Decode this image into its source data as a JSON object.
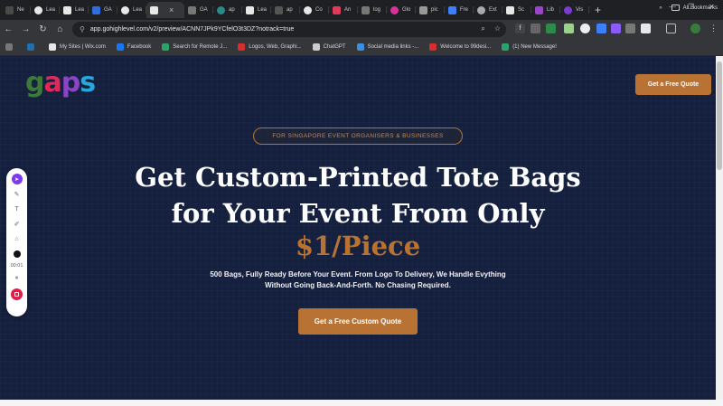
{
  "browser": {
    "tabs": [
      {
        "label": "Ne",
        "color": "#4a4a4a"
      },
      {
        "label": "Lea",
        "color": "#e8e8e8"
      },
      {
        "label": "Lea",
        "color": "#e8e8e8"
      },
      {
        "label": "GA",
        "color": "#2f6fdd"
      },
      {
        "label": "Lea",
        "color": "#e8e8e8"
      },
      {
        "label": "",
        "color": "#e8e8e8",
        "active": true
      },
      {
        "label": "GA",
        "color": "#777777"
      },
      {
        "label": "ap",
        "color": "#2a8a8a"
      },
      {
        "label": "Lea",
        "color": "#e8e8e8"
      },
      {
        "label": "ap",
        "color": "#555555"
      },
      {
        "label": "Co",
        "color": "#e8e8e8"
      },
      {
        "label": "An",
        "color": "#e03a5a"
      },
      {
        "label": "log",
        "color": "#777777"
      },
      {
        "label": "Glo",
        "color": "#d6339a"
      },
      {
        "label": "pic",
        "color": "#999999"
      },
      {
        "label": "Fre",
        "color": "#3f7fff"
      },
      {
        "label": "Ext",
        "color": "#aaaaaa"
      },
      {
        "label": "Sc",
        "color": "#e8e8e8"
      },
      {
        "label": "Lib",
        "color": "#9a44c8"
      },
      {
        "label": "Vis",
        "color": "#7a3bd1"
      }
    ],
    "url": "app.gohighlevel.com/v2/preview/ACNN7JPk9YCfelO3t3DZ?notrack=true",
    "bookmarks": [
      {
        "label": "",
        "color": "#777777"
      },
      {
        "label": "",
        "color": "#1f6fb0"
      },
      {
        "label": "My Sites | Wix.com",
        "color": "#e8e8e8"
      },
      {
        "label": "Facebook",
        "color": "#1877f2"
      },
      {
        "label": "Search for Remote J...",
        "color": "#2ba36a"
      },
      {
        "label": "Logos, Web, Graphi...",
        "color": "#d62d2d"
      },
      {
        "label": "ChatGPT",
        "color": "#cccccc"
      },
      {
        "label": "Social media links -...",
        "color": "#3b8ee0"
      },
      {
        "label": "Welcome to 99desi...",
        "color": "#d62d2d"
      },
      {
        "label": "(1) New Message!",
        "color": "#2ba36a"
      }
    ],
    "all_bookmarks": "All Bookmarks"
  },
  "page": {
    "logo": {
      "g": "g",
      "a": "a",
      "p": "p",
      "s": "s"
    },
    "header_cta": "Get a Free Quote",
    "pill": "FOR SINGAPORE EVENT ORGANISERS & BUSINESSES",
    "headline_line1": "Get Custom-Printed Tote Bags",
    "headline_line2": "for Your Event From Only",
    "price": "$1/Piece",
    "sub_line1": "500 Bags, Fully Ready Before Your Event. From Logo To Delivery, We Handle Evything",
    "sub_line2": "Without Going Back-And-Forth. No Chasing Required.",
    "main_cta": "Get a Free Custom Quote",
    "accent": "#b87334",
    "background": "#15203f"
  },
  "recorder": {
    "timer": "00:01"
  }
}
